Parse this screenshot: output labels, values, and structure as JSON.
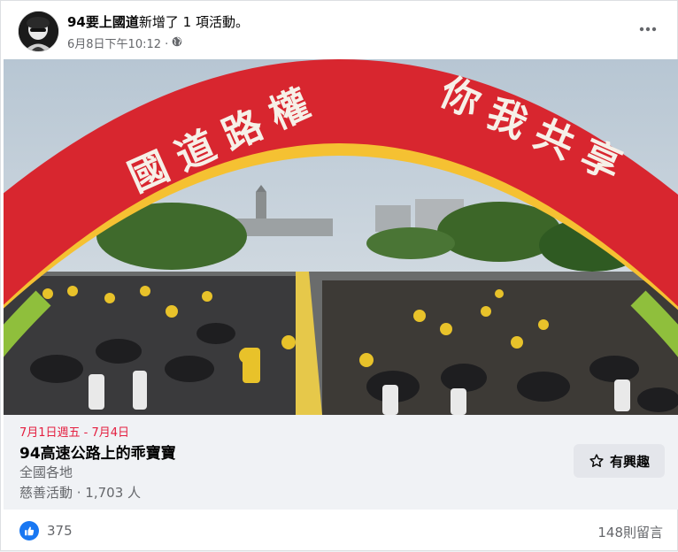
{
  "post": {
    "page_name": "94要上國道",
    "activity_text": "新增了 1 項活動。",
    "timestamp": "6月8日下午10:12 ·",
    "privacy_icon": "globe-icon",
    "more_icon": "more-options-icon"
  },
  "photo": {
    "banner_left": "國道路權",
    "banner_right": "你我共享"
  },
  "event": {
    "date": "7月1日週五 - 7月4日",
    "title": "94高速公路上的乖寶寶",
    "location": "全國各地",
    "subtitle": "慈善活動 · 1,703 人",
    "interested_label": "有興趣",
    "interested_icon": "star-outline-icon"
  },
  "footer": {
    "like_icon": "thumbs-up-icon",
    "like_count": "375",
    "comment_count": "148則留言"
  },
  "colors": {
    "accent_blue": "#1877f2",
    "date_red": "#e41e3f",
    "secondary_text": "#65676b",
    "banner_red": "#d8262f",
    "banner_yellow": "#f5c132"
  }
}
